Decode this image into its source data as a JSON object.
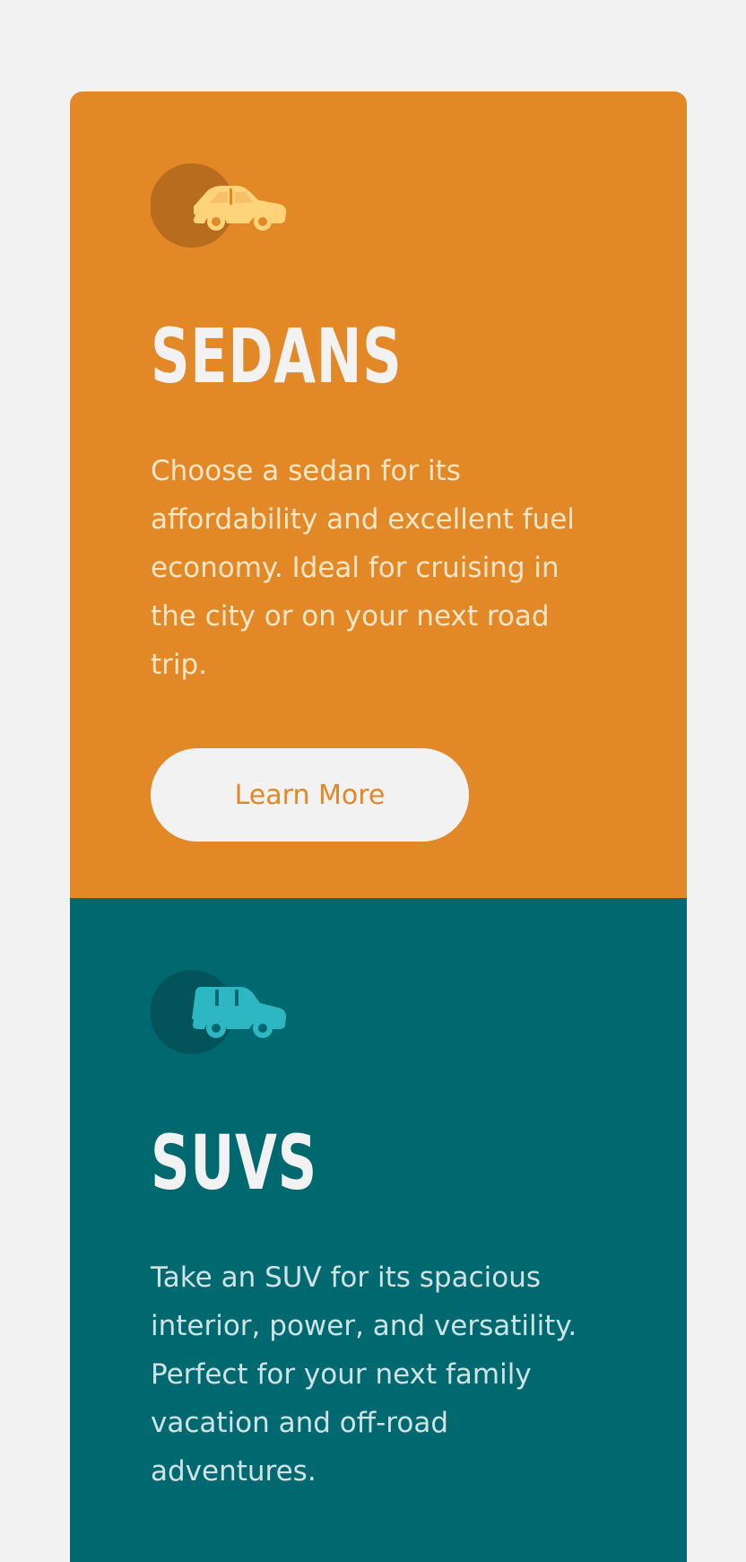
{
  "colors": {
    "page_bg": "#f2f2f2",
    "sedan_bg": "#e38826",
    "suv_bg": "#006970",
    "sedan_icon": "#ffd37a",
    "suv_icon": "#2db7c2",
    "button_bg": "#f2f2f2",
    "button_text": "#e38826"
  },
  "cards": [
    {
      "icon": "sedan-car-icon",
      "title": "SEDANS",
      "description": "Choose a sedan for its affordability and excellent fuel economy. Ideal for cruising in the city or on your next road trip.",
      "button_label": "Learn More"
    },
    {
      "icon": "suv-car-icon",
      "title": "SUVS",
      "description": "Take an SUV for its spacious interior, power, and versatility. Perfect for your next family vacation and off-road adventures."
    }
  ]
}
